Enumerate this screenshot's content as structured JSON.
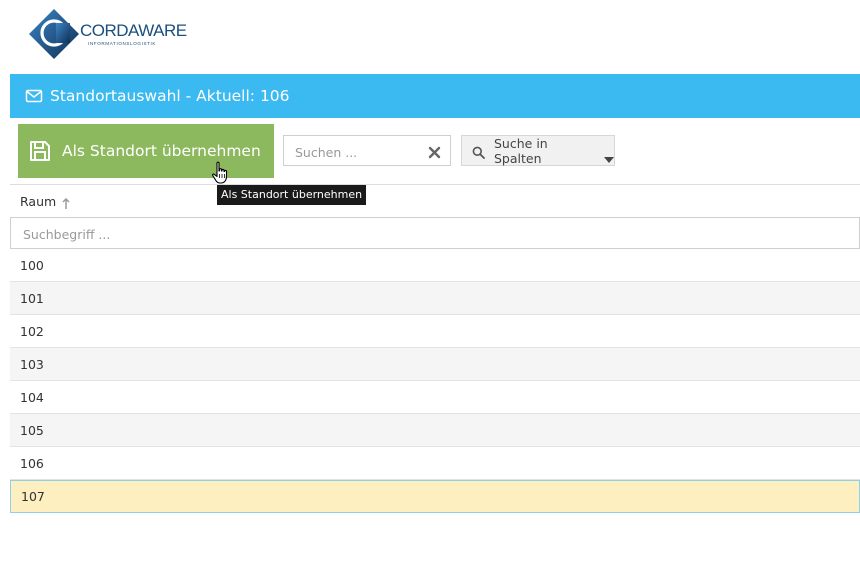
{
  "logo": {
    "text": "CORDAWARE",
    "subtitle": "INFORMATIONSLOGISTIK"
  },
  "header": {
    "title": "Standortauswahl - Aktuell: 106",
    "icon": "envelope-icon",
    "color": "#3bb9f1"
  },
  "toolbar": {
    "primary_label": "Als Standort übernehmen",
    "primary_color": "#8cb85e",
    "search_placeholder": "Suchen ...",
    "column_search_label": "Suche in Spalten",
    "tooltip": "Als Standort übernehmen"
  },
  "grid": {
    "column": "Raum",
    "sort": "ascending",
    "filter_placeholder": "Suchbegriff ...",
    "rows": [
      "100",
      "101",
      "102",
      "103",
      "104",
      "105",
      "106",
      "107"
    ],
    "selected": "107"
  }
}
